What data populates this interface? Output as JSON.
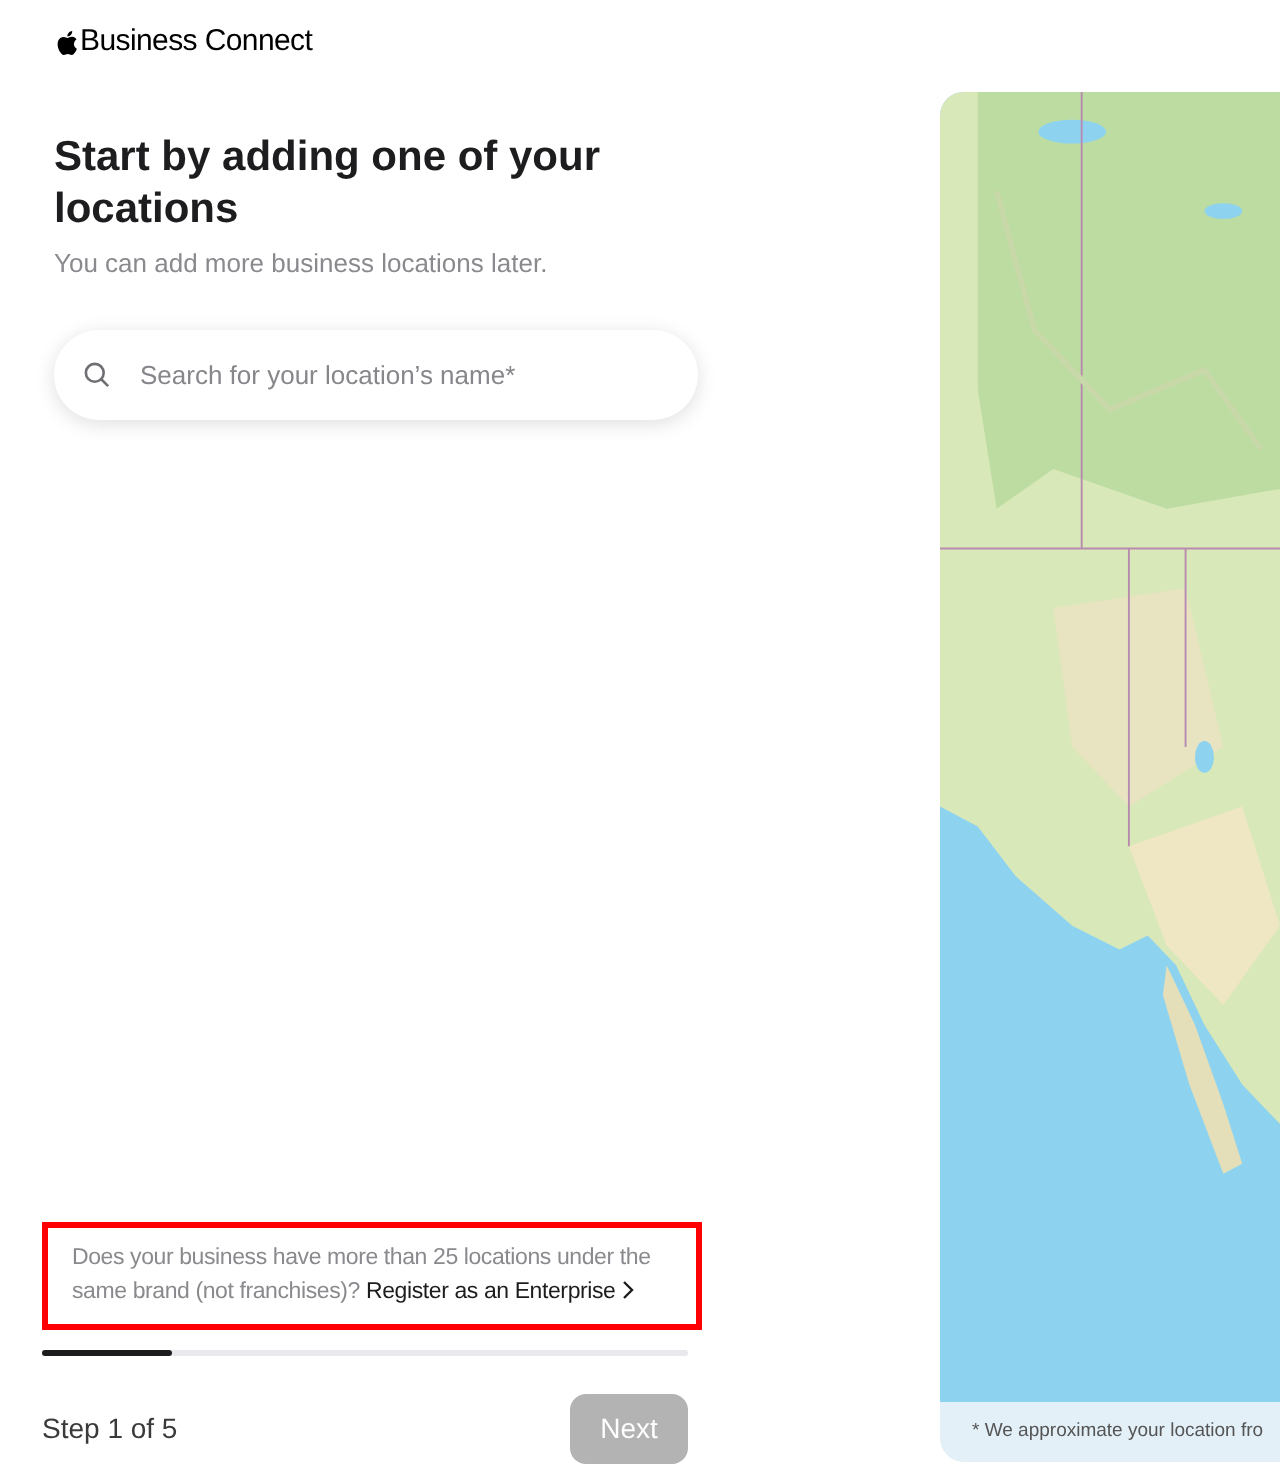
{
  "brand": {
    "name": "Business Connect"
  },
  "heading": "Start by adding one of your locations",
  "subheading": "You can add more business locations later.",
  "search": {
    "placeholder": "Search for your location’s name*"
  },
  "enterprise_notice": {
    "text": "Does your business have more than 25 locations under the same brand (not franchises)?",
    "link": "Register as an Enterprise",
    "highlighted": true
  },
  "progress": {
    "level": 0.2
  },
  "step": "Step 1 of 5",
  "next_button": {
    "label": "Next",
    "disabled": true
  },
  "map": {
    "kind": "picture",
    "caption": "* We approximate your location fro"
  }
}
